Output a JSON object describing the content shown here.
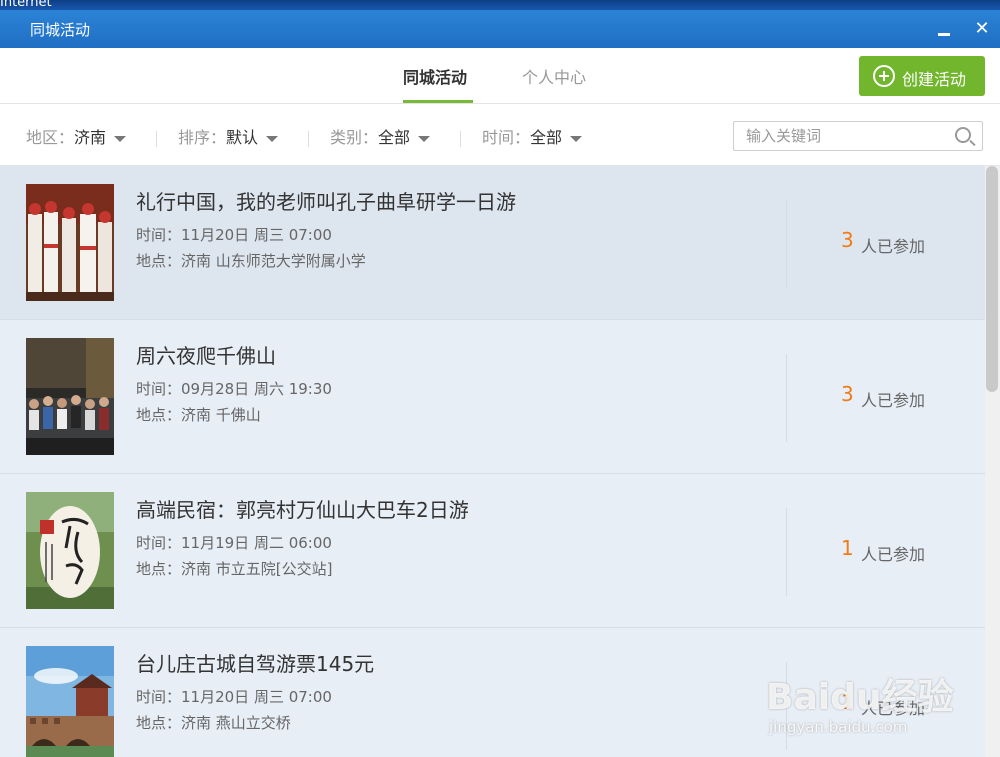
{
  "desktop": {
    "label": "Internet"
  },
  "window": {
    "title": "同城活动",
    "min_glyph": "_",
    "close_glyph": "✕"
  },
  "tabs": {
    "city": "同城活动",
    "personal": "个人中心",
    "active": "city"
  },
  "create_button": {
    "label": "创建活动"
  },
  "filters": [
    {
      "key": "地区：",
      "value": "济南"
    },
    {
      "key": "排序：",
      "value": "默认"
    },
    {
      "key": "类别：",
      "value": "全部"
    },
    {
      "key": "时间：",
      "value": "全部"
    }
  ],
  "search": {
    "placeholder": "输入关键词",
    "value": ""
  },
  "events": [
    {
      "name": "礼行中国，我的老师叫孔子曲阜研学一日游",
      "time": "时间：11月20日 周三 07:00",
      "place": "地点：济南 山东师范大学附属小学",
      "count": "3",
      "joined": "人已参加"
    },
    {
      "name": "周六夜爬千佛山",
      "time": "时间：09月28日 周六 19:30",
      "place": "地点：济南 千佛山",
      "count": "3",
      "joined": "人已参加"
    },
    {
      "name": "高端民宿：郭亮村万仙山大巴车2日游",
      "time": "时间：11月19日 周二 06:00",
      "place": "地点：济南 市立五院[公交站]",
      "count": "1",
      "joined": "人已参加"
    },
    {
      "name": "台儿庄古城自驾游票145元",
      "time": "时间：11月20日 周三 07:00",
      "place": "地点：济南 燕山立交桥",
      "count": "1",
      "joined": "人已参加"
    }
  ],
  "watermark": {
    "logo": "Baidu经验",
    "sub": "jingyan.baidu.com"
  },
  "colors": {
    "accent_green": "#71b62d",
    "count_orange": "#f07b17",
    "titlebar_blue": "#2c83d6",
    "list_bg": "#e8eef6"
  }
}
